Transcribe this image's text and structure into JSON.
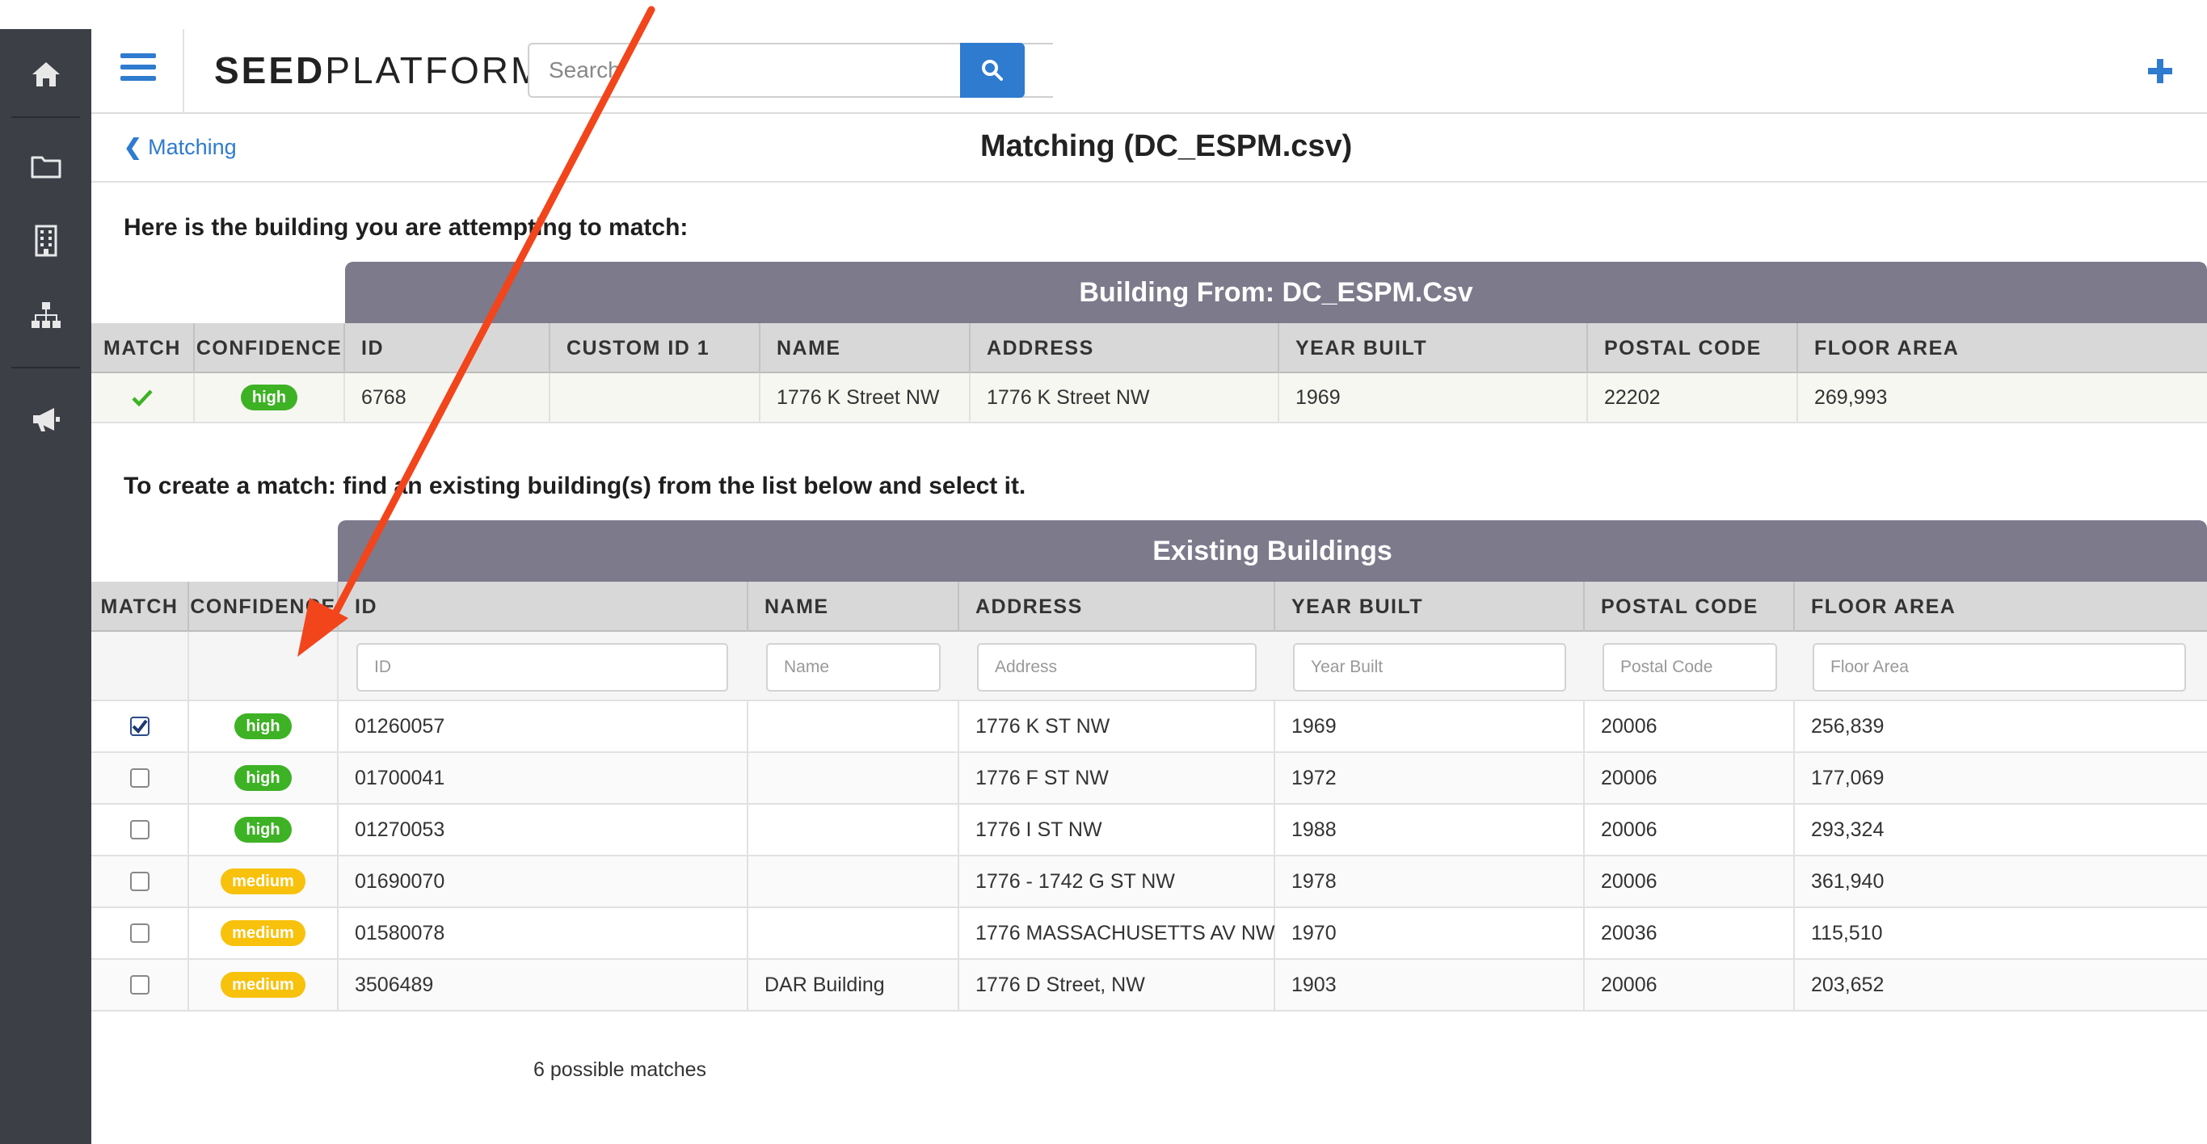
{
  "header": {
    "brand_bold": "SEED",
    "brand_light": "PLATFORM",
    "search_placeholder": "Search"
  },
  "subheader": {
    "back_label": "Matching",
    "title": "Matching (DC_ESPM.csv)"
  },
  "source": {
    "instruction": "Here is the building you are attempting to match:",
    "banner": "Building From: DC_ESPM.Csv",
    "columns": [
      "MATCH",
      "CONFIDENCE",
      "ID",
      "CUSTOM ID 1",
      "NAME",
      "ADDRESS",
      "YEAR BUILT",
      "POSTAL CODE",
      "FLOOR AREA"
    ],
    "row": {
      "confidence": "high",
      "id": "6768",
      "custom_id": "",
      "name": "1776 K Street NW",
      "address": "1776 K Street NW",
      "year_built": "1969",
      "postal_code": "22202",
      "floor_area": "269,993"
    }
  },
  "existing": {
    "instruction": "To create a match: find an existing building(s) from the list below and select it.",
    "banner": "Existing Buildings",
    "columns": [
      "MATCH",
      "CONFIDENCE",
      "ID",
      "NAME",
      "ADDRESS",
      "YEAR BUILT",
      "POSTAL CODE",
      "FLOOR AREA"
    ],
    "filters": {
      "id": "ID",
      "name": "Name",
      "address": "Address",
      "year_built": "Year Built",
      "postal_code": "Postal Code",
      "floor_area": "Floor Area"
    },
    "rows": [
      {
        "checked": true,
        "confidence": "high",
        "id": "01260057",
        "name": "",
        "address": "1776 K ST NW",
        "year_built": "1969",
        "postal_code": "20006",
        "floor_area": "256,839"
      },
      {
        "checked": false,
        "confidence": "high",
        "id": "01700041",
        "name": "",
        "address": "1776 F ST NW",
        "year_built": "1972",
        "postal_code": "20006",
        "floor_area": "177,069"
      },
      {
        "checked": false,
        "confidence": "high",
        "id": "01270053",
        "name": "",
        "address": "1776 I ST NW",
        "year_built": "1988",
        "postal_code": "20006",
        "floor_area": "293,324"
      },
      {
        "checked": false,
        "confidence": "medium",
        "id": "01690070",
        "name": "",
        "address": "1776 - 1742 G ST NW",
        "year_built": "1978",
        "postal_code": "20006",
        "floor_area": "361,940"
      },
      {
        "checked": false,
        "confidence": "medium",
        "id": "01580078",
        "name": "",
        "address": "1776 MASSACHUSETTS AV NW",
        "year_built": "1970",
        "postal_code": "20036",
        "floor_area": "115,510"
      },
      {
        "checked": false,
        "confidence": "medium",
        "id": "3506489",
        "name": "DAR Building",
        "address": "1776 D Street, NW",
        "year_built": "1903",
        "postal_code": "20006",
        "floor_area": "203,652"
      }
    ],
    "count_text": "6 possible matches"
  },
  "colors": {
    "accent": "#2e7bcf",
    "sidebar": "#3d3f47",
    "banner": "#7c7a8b",
    "high": "#3db224",
    "medium": "#f8c10c",
    "arrow": "#f2451c"
  }
}
